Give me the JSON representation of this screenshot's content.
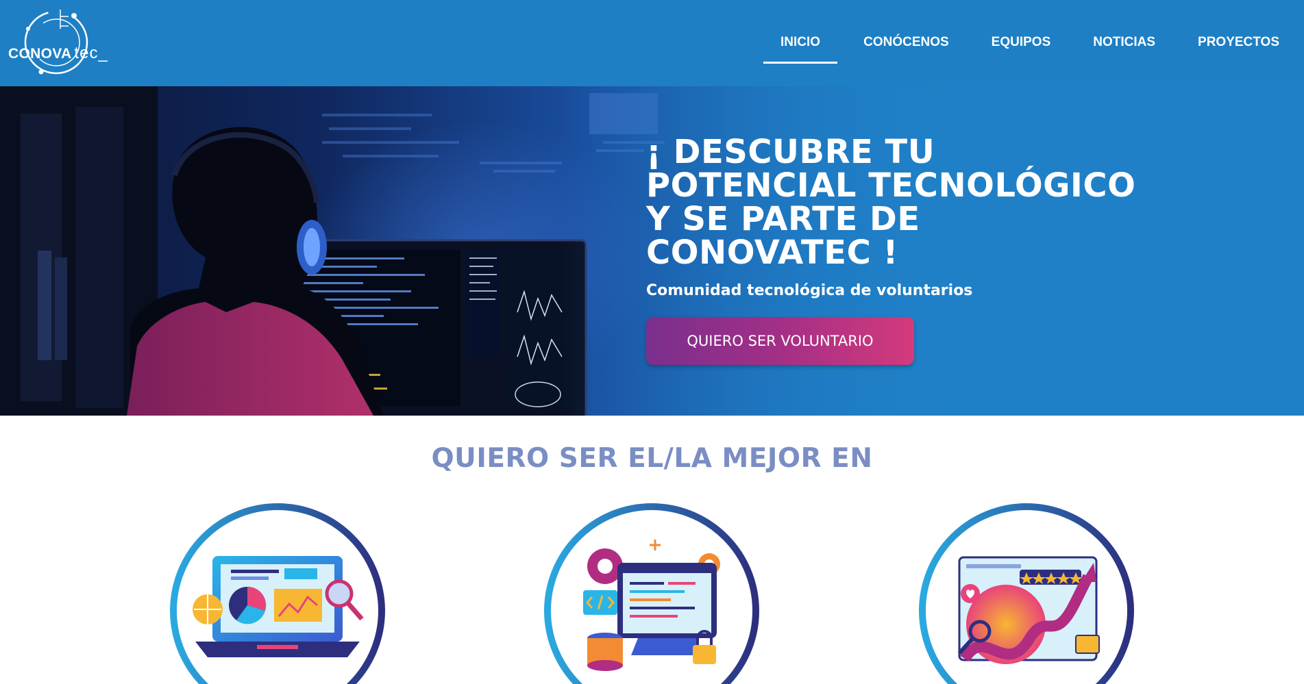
{
  "header": {
    "logo": {
      "word_bold": "CONOVA",
      "word_thin": "tec_"
    },
    "nav": [
      {
        "label": "INICIO",
        "active": true
      },
      {
        "label": "CONÓCENOS",
        "active": false
      },
      {
        "label": "EQUIPOS",
        "active": false
      },
      {
        "label": "NOTICIAS",
        "active": false
      },
      {
        "label": "PROYECTOS",
        "active": false
      }
    ]
  },
  "hero": {
    "title": "¡ DESCUBRE TU POTENCIAL TECNOLÓGICO Y SE PARTE DE CONOVATEC !",
    "subtitle": "Comunidad tecnológica de voluntarios",
    "cta_label": "QUIERO SER VOLUNTARIO",
    "image": "developer-with-headphones-at-monitor"
  },
  "section": {
    "title": "QUIERO SER EL/LA MEJOR EN",
    "cards": [
      {
        "icon": "data-analytics-laptop-icon"
      },
      {
        "icon": "software-development-monitor-icon"
      },
      {
        "icon": "digital-marketing-growth-icon"
      }
    ]
  },
  "colors": {
    "header_bg": "#1e7fc4",
    "section_title": "#7a8ec4",
    "cta_gradient_start": "#7a2f8e",
    "cta_gradient_end": "#d43a7c",
    "ring_light": "#2aa9e0",
    "ring_dark": "#2d2f7e"
  }
}
